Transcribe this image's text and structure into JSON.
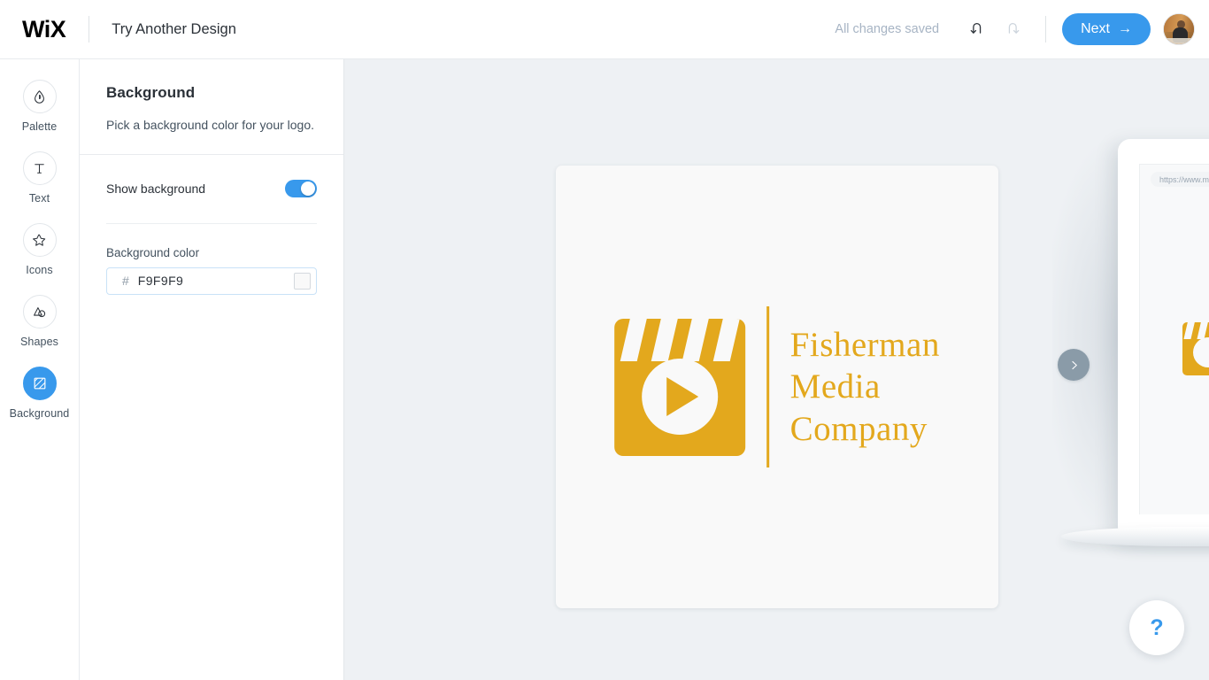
{
  "topbar": {
    "brand": "WiX",
    "page_action": "Try Another Design",
    "save_status": "All changes saved",
    "undo_icon": "undo-icon",
    "redo_icon": "redo-icon",
    "next_label": "Next",
    "next_arrow": "→",
    "avatar_alt": "user-avatar",
    "accent_color": "#3899EC"
  },
  "sidebar": {
    "items": [
      {
        "label": "Palette",
        "icon": "droplet-icon",
        "active": false
      },
      {
        "label": "Text",
        "icon": "text-t-icon",
        "active": false
      },
      {
        "label": "Icons",
        "icon": "star-icon",
        "active": false
      },
      {
        "label": "Shapes",
        "icon": "shapes-icon",
        "active": false
      },
      {
        "label": "Background",
        "icon": "background-hatch-icon",
        "active": true
      }
    ]
  },
  "panel": {
    "title": "Background",
    "subtitle": "Pick a background color for your logo.",
    "toggle_label": "Show background",
    "toggle_on": true,
    "color_label": "Background color",
    "hash": "#",
    "color_value": "F9F9F9",
    "swatch_color": "#F9F9F9"
  },
  "canvas": {
    "background_color": "#F9F9F9",
    "stage_color": "#EEF1F4",
    "logo": {
      "brand_color": "#E3A81D",
      "icon_name": "clapperboard-play-icon",
      "text_line_1": "Fisherman",
      "text_line_2": "Media",
      "text_line_3": "Company"
    },
    "next_design_icon": "chevron-right-icon",
    "device_preview": {
      "url": "https://www.m"
    }
  },
  "help": {
    "label": "?",
    "icon": "question-mark-icon"
  }
}
